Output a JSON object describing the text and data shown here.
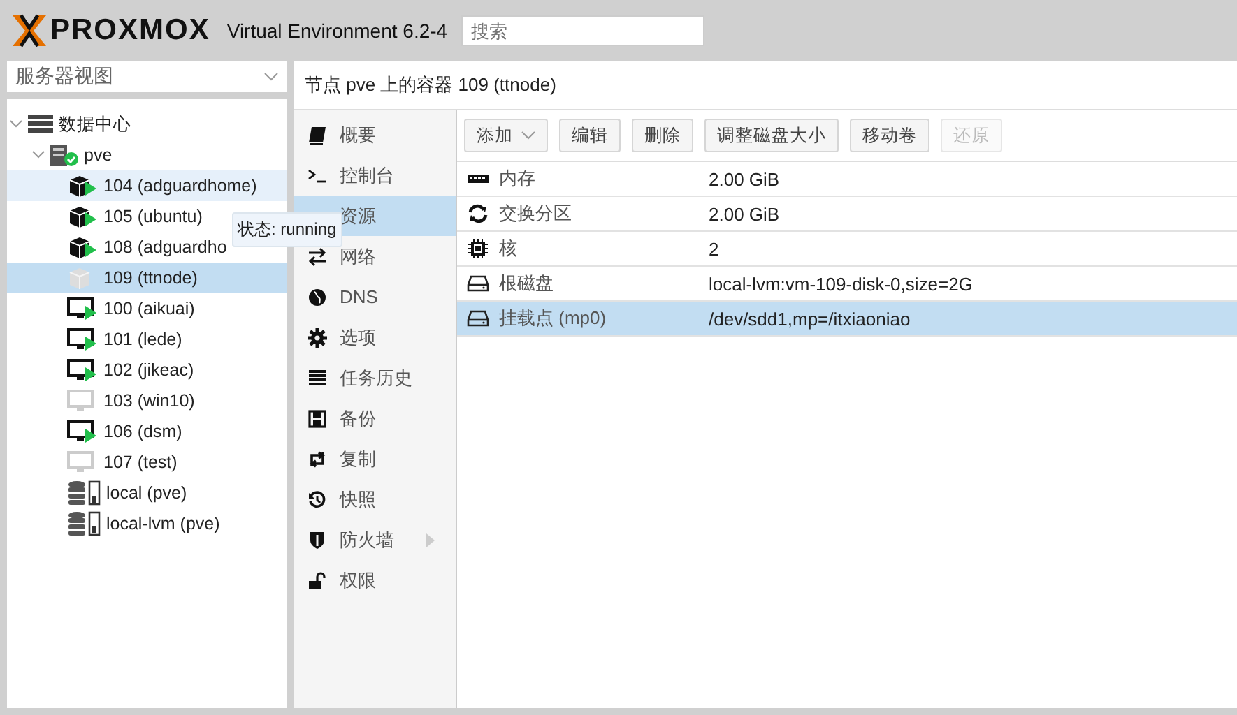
{
  "header": {
    "logo": "PROXMOX",
    "version": "Virtual Environment 6.2-4",
    "search": {
      "placeholder": "搜索"
    }
  },
  "sidebar": {
    "view_select": "服务器视图",
    "tree": [
      {
        "label": "数据中心",
        "kind": "datacenter",
        "expanded": true,
        "selected": false,
        "children": [
          {
            "label": "pve",
            "kind": "node",
            "expanded": true,
            "selected": false,
            "children": [
              {
                "label": "104 (adguardhome)",
                "kind": "container",
                "running": true,
                "selected": false,
                "hovered": true
              },
              {
                "label": "105 (ubuntu)",
                "kind": "container",
                "running": true,
                "selected": false,
                "hovered": false
              },
              {
                "label": "108 (adguardho",
                "kind": "container",
                "running": true,
                "selected": false,
                "hovered": false
              },
              {
                "label": "109 (ttnode)",
                "kind": "container",
                "running": false,
                "selected": true,
                "hovered": false
              },
              {
                "label": "100 (aikuai)",
                "kind": "vm",
                "running": true,
                "selected": false,
                "hovered": false
              },
              {
                "label": "101 (lede)",
                "kind": "vm",
                "running": true,
                "selected": false,
                "hovered": false
              },
              {
                "label": "102 (jikeac)",
                "kind": "vm",
                "running": true,
                "selected": false,
                "hovered": false
              },
              {
                "label": "103 (win10)",
                "kind": "vm",
                "running": false,
                "selected": false,
                "hovered": false
              },
              {
                "label": "106 (dsm)",
                "kind": "vm",
                "running": true,
                "selected": false,
                "hovered": false
              },
              {
                "label": "107 (test)",
                "kind": "vm",
                "running": false,
                "selected": false,
                "hovered": false
              },
              {
                "label": "local (pve)",
                "kind": "storage",
                "selected": false,
                "hovered": false
              },
              {
                "label": "local-lvm (pve)",
                "kind": "storage",
                "selected": false,
                "hovered": false
              }
            ]
          }
        ]
      }
    ]
  },
  "tooltip": {
    "text": "状态: running"
  },
  "panel": {
    "title": "节点 pve 上的容器 109 (ttnode)",
    "nav": [
      {
        "label": "概要",
        "selected": false
      },
      {
        "label": "控制台",
        "selected": false
      },
      {
        "label": "资源",
        "selected": true
      },
      {
        "label": "网络",
        "selected": false
      },
      {
        "label": "DNS",
        "selected": false
      },
      {
        "label": "选项",
        "selected": false
      },
      {
        "label": "任务历史",
        "selected": false
      },
      {
        "label": "备份",
        "selected": false
      },
      {
        "label": "复制",
        "selected": false
      },
      {
        "label": "快照",
        "selected": false
      },
      {
        "label": "防火墙",
        "selected": false,
        "has_submenu": true
      },
      {
        "label": "权限",
        "selected": false
      }
    ],
    "toolbar": [
      {
        "label": "添加",
        "menu": true,
        "disabled": false
      },
      {
        "label": "编辑",
        "menu": false,
        "disabled": false
      },
      {
        "label": "删除",
        "menu": false,
        "disabled": false
      },
      {
        "label": "调整磁盘大小",
        "menu": false,
        "disabled": false
      },
      {
        "label": "移动卷",
        "menu": false,
        "disabled": false
      },
      {
        "label": "还原",
        "menu": false,
        "disabled": true
      }
    ],
    "rows": [
      {
        "kind": "memory",
        "name": "内存",
        "value": "2.00 GiB",
        "selected": false
      },
      {
        "kind": "swap",
        "name": "交换分区",
        "value": "2.00 GiB",
        "selected": false
      },
      {
        "kind": "cpu",
        "name": "核",
        "value": "2",
        "selected": false
      },
      {
        "kind": "disk",
        "name": "根磁盘",
        "value": "local-lvm:vm-109-disk-0,size=2G",
        "selected": false
      },
      {
        "kind": "disk",
        "name": "挂载点 (mp0)",
        "value": "/dev/sdd1,mp=/itxiaoniao",
        "selected": true
      }
    ]
  }
}
